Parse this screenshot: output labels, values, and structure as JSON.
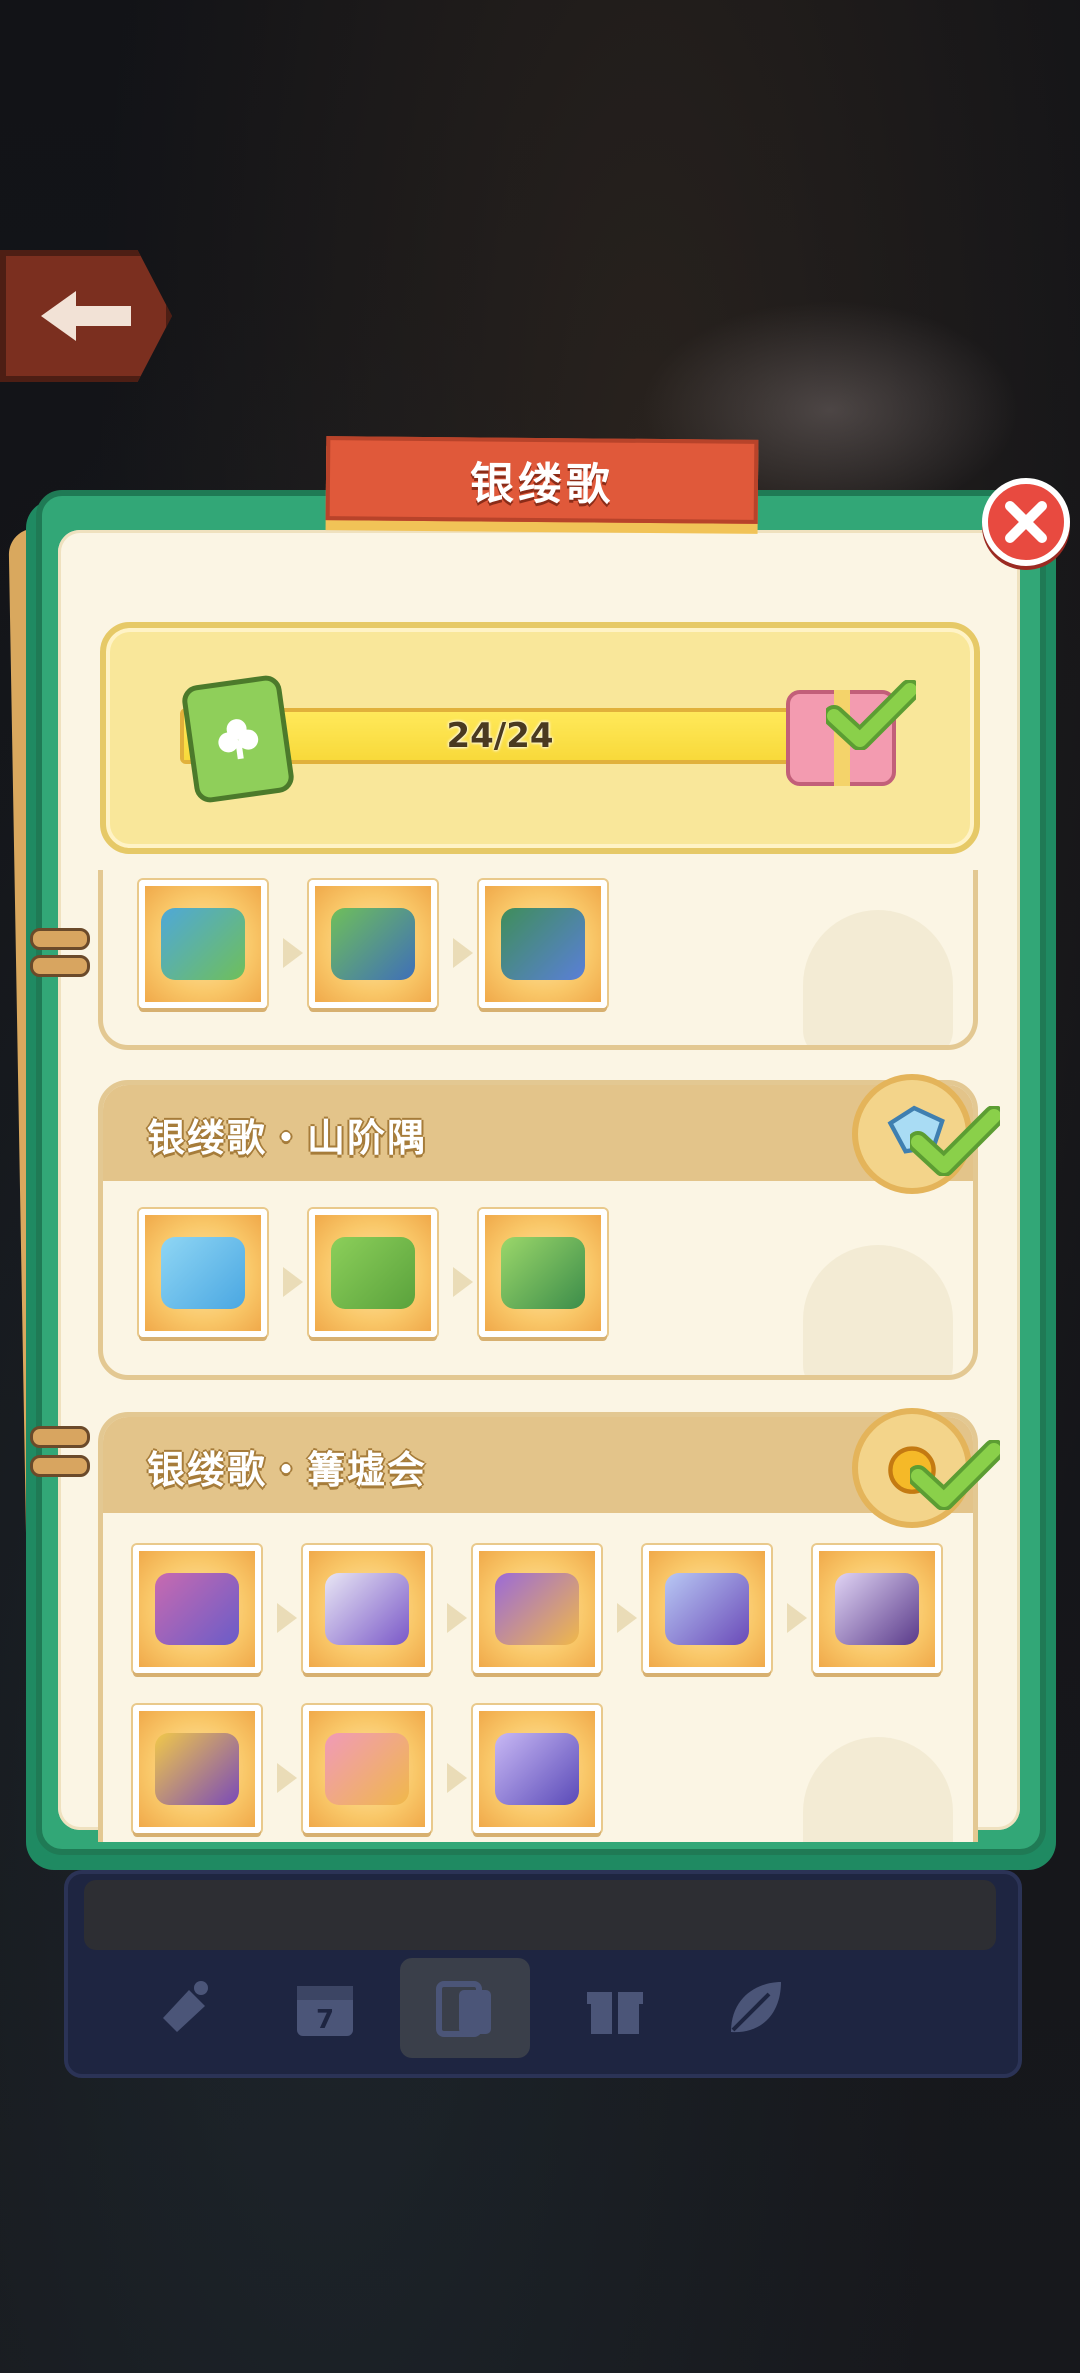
{
  "title": "银缕歌",
  "progress": {
    "current": 24,
    "total": 24,
    "label": "24/24",
    "fraction": 1.0
  },
  "sections": [
    {
      "title": "",
      "completed": true,
      "item_count": 3
    },
    {
      "title": "银缕歌・山阶隅",
      "completed": true,
      "item_count": 3,
      "reward": "crystal-icon"
    },
    {
      "title": "银缕歌・篝墟会",
      "completed": true,
      "item_count": 8,
      "reward": "coin-icon"
    }
  ],
  "tabs": [
    {
      "icon": "hand-bell-icon"
    },
    {
      "icon": "calendar-icon",
      "label": "7"
    },
    {
      "icon": "cards-icon",
      "active": true
    },
    {
      "icon": "gift-icon"
    },
    {
      "icon": "leaf-icon"
    }
  ],
  "colors": {
    "accent_green": "#32a777",
    "banner_red": "#e0593a",
    "progress_yellow": "#f8d93a",
    "close_red": "#e84a40"
  }
}
